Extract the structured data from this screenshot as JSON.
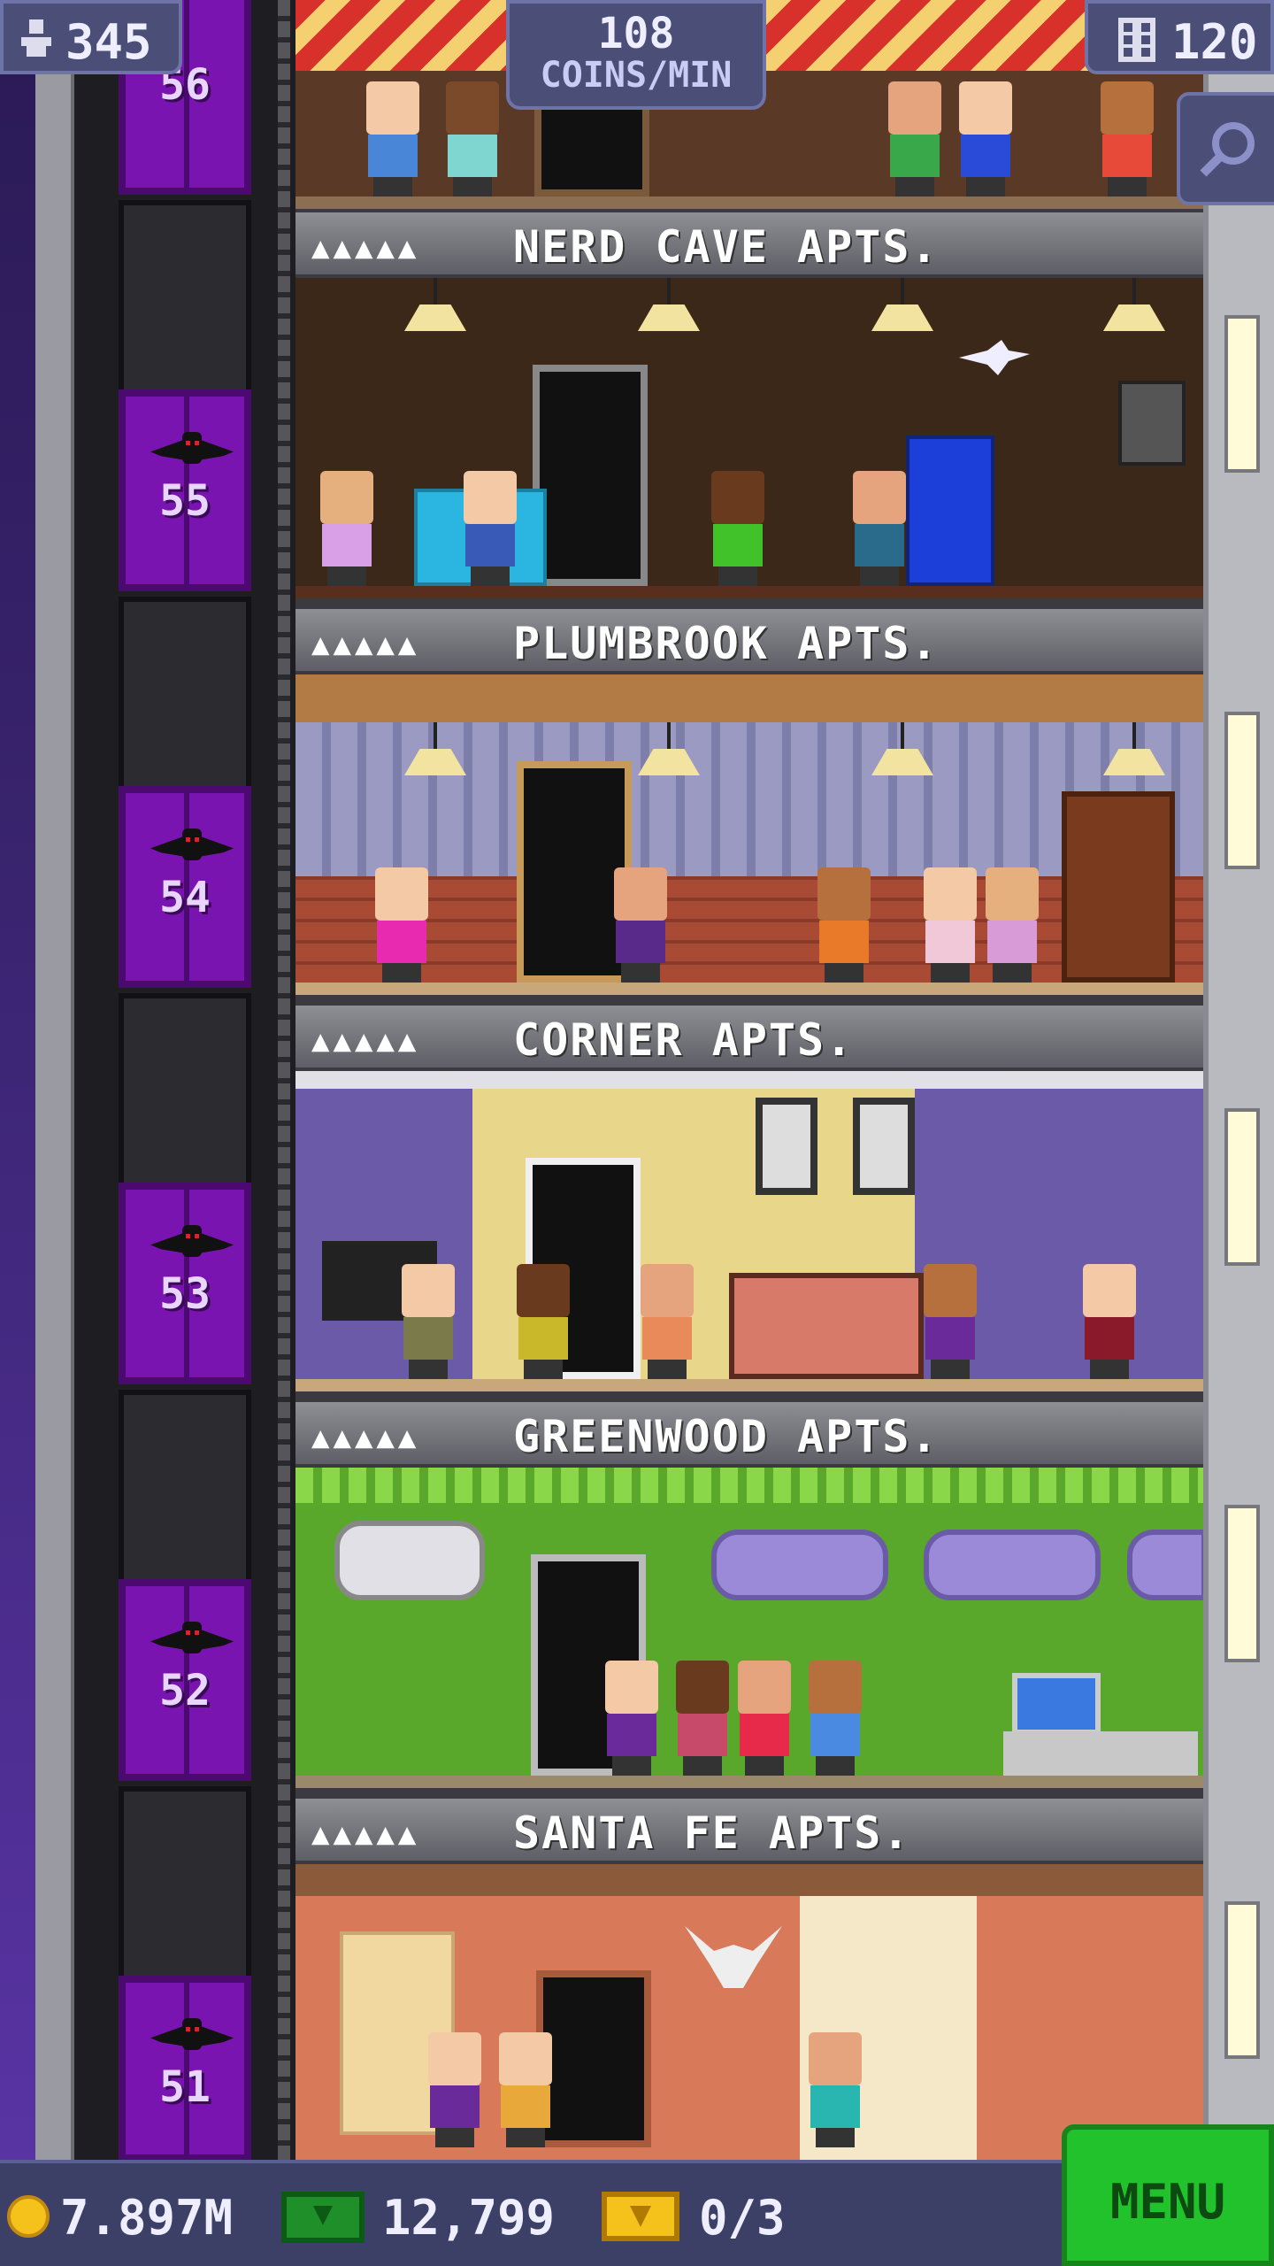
{
  "hud": {
    "population": "345",
    "coins_per_min_value": "108",
    "coins_per_min_label": "COINS/MIN",
    "floor_count": "120"
  },
  "elevator": {
    "floors": [
      "56",
      "55",
      "54",
      "53",
      "52",
      "51"
    ]
  },
  "floors": [
    {
      "name": "NERD CAVE APTS.",
      "stars": "▲▲▲▲▲",
      "room_color": "#3b2818"
    },
    {
      "name": "PLUMBROOK APTS.",
      "stars": "▲▲▲▲▲",
      "room_color": "#8e8fb8"
    },
    {
      "name": "CORNER APTS.",
      "stars": "▲▲▲▲▲",
      "room_color": "#6a5aa8"
    },
    {
      "name": "GREENWOOD APTS.",
      "stars": "▲▲▲▲▲",
      "room_color": "#59a82b"
    },
    {
      "name": "SANTA FE APTS.",
      "stars": "▲▲▲▲▲",
      "room_color": "#d87a5a"
    }
  ],
  "bottom_bar": {
    "coins": "7.897M",
    "tower_bux": "12,799",
    "tickets": "0/3",
    "menu_label": "MENU"
  },
  "colors": {
    "hud_bg": "#4b4f78",
    "elevator_purple": "#7a14b0",
    "menu_green": "#22c22c",
    "coin_gold": "#f5c21c"
  }
}
